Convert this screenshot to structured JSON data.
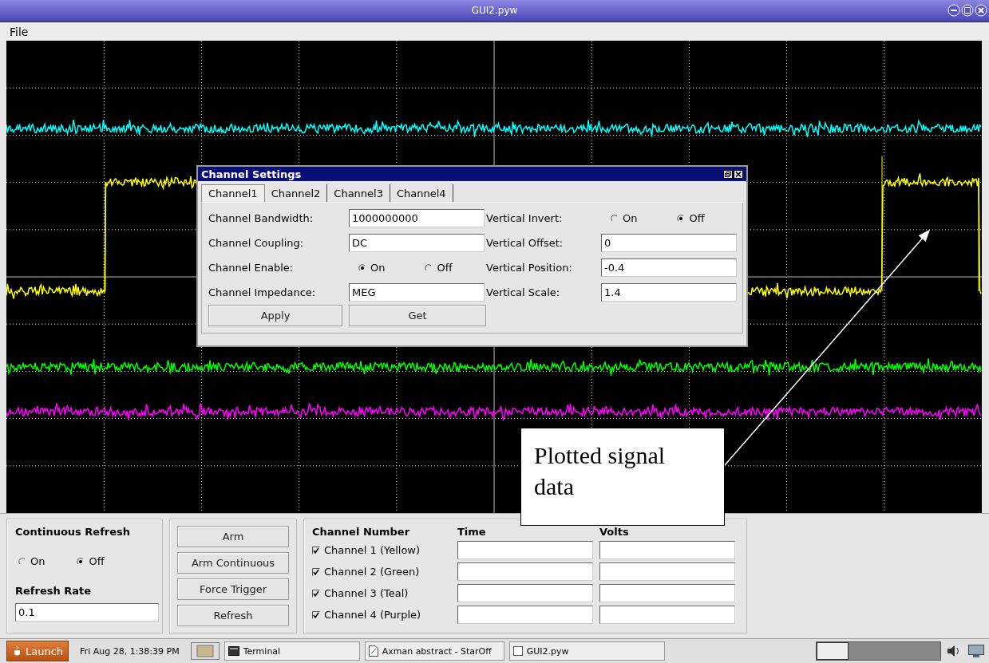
{
  "window": {
    "title": "GUI2.pyw"
  },
  "menu": [
    "File"
  ],
  "dialog": {
    "title": "Channel Settings",
    "tabs": [
      {
        "label": "Channel1",
        "selected": true
      },
      {
        "label": "Channel2",
        "selected": false
      },
      {
        "label": "Channel3",
        "selected": false
      },
      {
        "label": "Channel4",
        "selected": false
      }
    ],
    "rows": [
      [
        {
          "label": "Channel Bandwidth:",
          "kind": "text",
          "value": "1000000000"
        },
        {
          "label": "Vertical Invert:",
          "kind": "radio",
          "options": [
            {
              "label": "On",
              "selected": false
            },
            {
              "label": "Off",
              "selected": true
            }
          ]
        }
      ],
      [
        {
          "label": "Channel Coupling:",
          "kind": "text",
          "value": "DC"
        },
        {
          "label": "Vertical Offset:",
          "kind": "text",
          "value": "0"
        }
      ],
      [
        {
          "label": "Channel Enable:",
          "kind": "radio",
          "options": [
            {
              "label": "On",
              "selected": true
            },
            {
              "label": "Off",
              "selected": false
            }
          ]
        },
        {
          "label": "Vertical Position:",
          "kind": "text",
          "value": "-0.4"
        }
      ],
      [
        {
          "label": "Channel Impedance:",
          "kind": "text",
          "value": "MEG"
        },
        {
          "label": "Vertical Scale:",
          "kind": "text",
          "value": "1.4"
        }
      ]
    ],
    "buttons": [
      "Apply",
      "Get"
    ]
  },
  "controls": {
    "continuous_refresh": {
      "label": "Continuous Refresh",
      "options": [
        {
          "label": "On",
          "selected": false
        },
        {
          "label": "Off",
          "selected": true
        }
      ]
    },
    "refresh_rate": {
      "label": "Refresh Rate",
      "value": "0.1"
    },
    "buttons": [
      "Arm",
      "Arm Continuous",
      "Force Trigger",
      "Refresh"
    ]
  },
  "channels": {
    "columns": [
      "Channel Number",
      "Time",
      "Volts"
    ],
    "rows": [
      {
        "label": "Channel 1 (Yellow)",
        "checked": true
      },
      {
        "label": "Channel 2 (Green)",
        "checked": true
      },
      {
        "label": "Channel 3 (Teal)",
        "checked": true
      },
      {
        "label": "Channel 4 (Purple)",
        "checked": true
      }
    ]
  },
  "annotation": {
    "text": "Plotted signal data"
  },
  "taskbar": {
    "launch": "Launch",
    "clock": "Fri Aug 28,  1:38:39 PM",
    "items": [
      {
        "label": "Terminal",
        "kind": "terminal"
      },
      {
        "label": "Axman abstract - StarOff",
        "kind": "document"
      },
      {
        "label": "GUI2.pyw",
        "kind": "window"
      }
    ]
  }
}
